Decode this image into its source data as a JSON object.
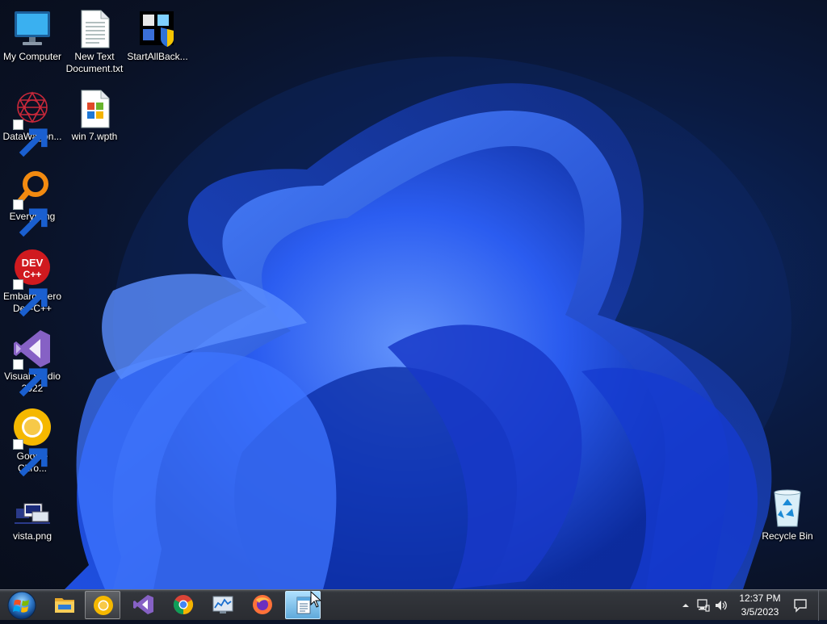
{
  "desktop": {
    "icons": [
      {
        "label": "My Computer",
        "icon": "computer-icon"
      },
      {
        "label": "New Text\nDocument.txt",
        "icon": "text-document-icon"
      },
      {
        "label": "StartAllBack...",
        "icon": "startallback-icon"
      },
      {
        "label": "DataWagon...",
        "icon": "datawagon-icon"
      },
      {
        "label": "win 7.wpth",
        "icon": "theme-file-icon"
      },
      {
        "label": "Everything",
        "icon": "everything-search-icon"
      },
      {
        "label": "Embarcadero\nDev-C++",
        "icon": "devcpp-icon"
      },
      {
        "label": "Visual Studio\n2022",
        "icon": "visual-studio-icon"
      },
      {
        "label": "Google\nChro...",
        "icon": "chrome-canary-icon"
      },
      {
        "label": "vista.png",
        "icon": "image-file-icon"
      },
      {
        "label": "Recycle Bin",
        "icon": "recycle-bin-icon"
      }
    ]
  },
  "taskbar": {
    "start": {
      "icon": "windows-start-orb-icon"
    },
    "items": [
      {
        "name": "file-explorer",
        "icon": "folder-icon"
      },
      {
        "name": "chrome-canary",
        "icon": "chrome-canary-icon",
        "state": "active"
      },
      {
        "name": "visual-studio",
        "icon": "visual-studio-icon"
      },
      {
        "name": "google-chrome",
        "icon": "chrome-icon"
      },
      {
        "name": "resource-monitor",
        "icon": "monitor-chart-icon"
      },
      {
        "name": "firefox",
        "icon": "firefox-icon"
      },
      {
        "name": "notepad",
        "icon": "notepad-icon",
        "state": "running"
      }
    ],
    "tray": {
      "time": "12:37 PM",
      "date": "3/5/2023"
    }
  },
  "colors": {
    "wallpaper_bg": "#0a1226",
    "bloom_blue": "#1f56f0",
    "taskbar": "#2e3035",
    "running_highlight": "#7cc4ee"
  }
}
